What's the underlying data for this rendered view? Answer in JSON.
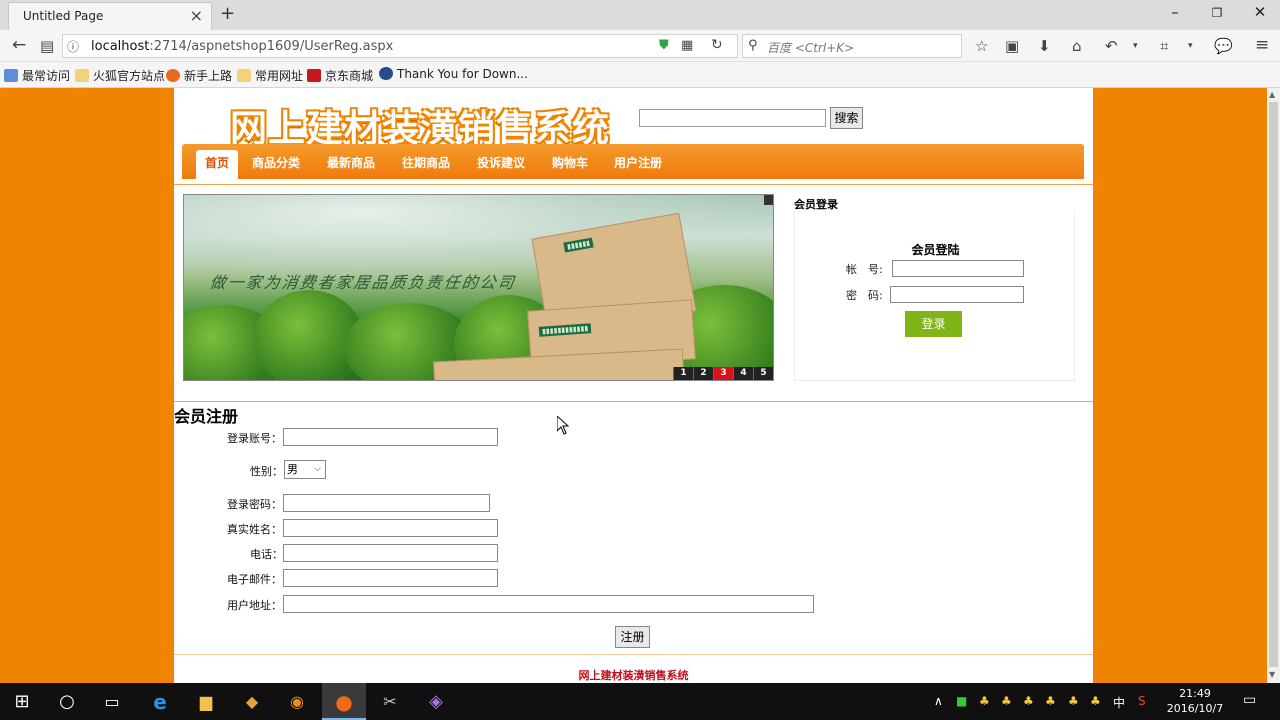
{
  "browser": {
    "tab_title": "Untitled Page",
    "url_host": "localhost",
    "url_path": ":2714/aspnetshop1609/UserReg.aspx",
    "search_placeholder": "百度 <Ctrl+K>",
    "bookmarks": [
      "最常访问",
      "火狐官方站点",
      "新手上路",
      "常用网址",
      "京东商城",
      "Thank You for Down..."
    ]
  },
  "site": {
    "logo": "网上建材装潢销售系统",
    "search_button": "搜索",
    "menu": [
      "首页",
      "商品分类",
      "最新商品",
      "往期商品",
      "投诉建议",
      "购物车",
      "用户注册"
    ],
    "banner_slogan": "做一家为消费者家居品质负责任的公司",
    "banner_pages": [
      "1",
      "2",
      "3",
      "4",
      "5"
    ],
    "banner_active_page": "3"
  },
  "login": {
    "section_title": "会员登录",
    "heading": "会员登陆",
    "account_label": "帐　号:",
    "password_label": "密　码:",
    "submit": "登录"
  },
  "register": {
    "title": "会员注册",
    "account_label": "登录账号：",
    "gender_label": "性别：",
    "gender_value": "男",
    "password_label": "登录密码：",
    "realname_label": "真实姓名：",
    "phone_label": "电话：",
    "email_label": "电子邮件：",
    "address_label": "用户地址：",
    "submit": "注册"
  },
  "footer": "网上建材装潢销售系统",
  "taskbar": {
    "time": "21:49",
    "date": "2016/10/7",
    "ime": "中"
  }
}
